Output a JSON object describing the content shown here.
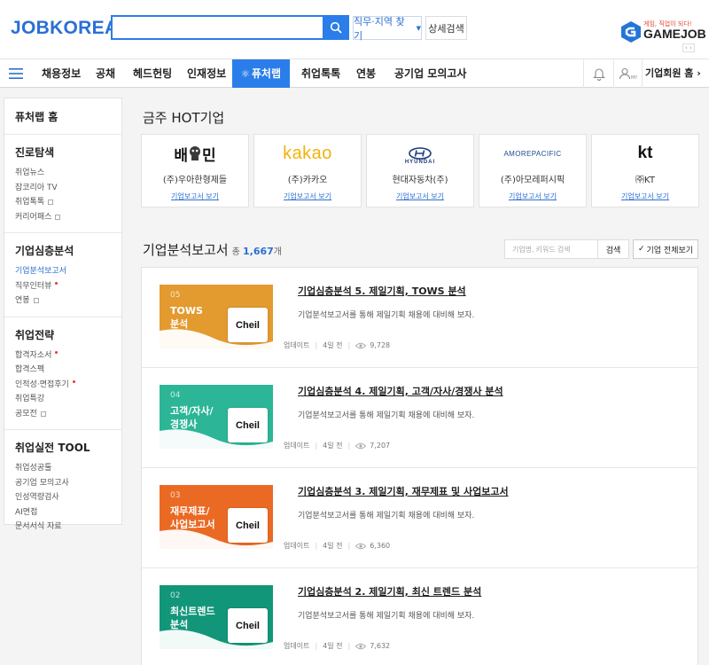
{
  "header": {
    "logo": "JOBKOREA",
    "search_placeholder": "",
    "region_button": "직무·지역 찾기",
    "detail_search_button": "상세검색",
    "gamejob_tagline": "게임, 직업이 되다!",
    "gamejob_name": "GAMEJOB",
    "gamejob_arrows": "‹ ›"
  },
  "nav": {
    "items": [
      "채용정보",
      "공채",
      "헤드헌팅",
      "인재정보",
      "퓨처랩",
      "취업톡톡",
      "연봉",
      "공기업 모의고사"
    ],
    "active_index": 4,
    "my_label": "MY",
    "corp_member": "기업회원 홈 ›"
  },
  "sidebar": {
    "home": "퓨처랩 홈",
    "sections": [
      {
        "title": "진로탐색",
        "items": [
          {
            "label": "취업뉴스"
          },
          {
            "label": "잡코리아 TV"
          },
          {
            "label": "취업톡톡",
            "box": true
          },
          {
            "label": "커리어패스",
            "box": true
          }
        ]
      },
      {
        "title": "기업심층분석",
        "items": [
          {
            "label": "기업분석보고서",
            "active": true
          },
          {
            "label": "직무인터뷰",
            "new": true
          },
          {
            "label": "연봉",
            "box": true
          }
        ]
      },
      {
        "title": "취업전략",
        "items": [
          {
            "label": "합격자소서",
            "new": true
          },
          {
            "label": "합격스펙"
          },
          {
            "label": "인적성·면접후기",
            "new": true
          },
          {
            "label": "취업특강"
          },
          {
            "label": "공모전",
            "box": true
          }
        ]
      },
      {
        "title": "취업실전 TOOL",
        "items": [
          {
            "label": "취업성공툴"
          },
          {
            "label": "공기업 모의고사"
          },
          {
            "label": "인성역량검사"
          },
          {
            "label": "AI면접"
          },
          {
            "label": "문서서식 자료"
          }
        ]
      }
    ]
  },
  "hot": {
    "title": "금주 HOT기업",
    "link_label": "기업보고서 보기",
    "companies": [
      {
        "logo_text": "배민",
        "logo_part1": "배",
        "logo_part2": "민",
        "name": "(주)우아한형제들"
      },
      {
        "logo_text": "kakao",
        "name": "(주)카카오"
      },
      {
        "logo_text": "HYUNDAI",
        "name": "현대자동차(주)"
      },
      {
        "logo_text": "AMOREPACIFIC",
        "name": "(주)아모레퍼시픽"
      },
      {
        "logo_text": "kt",
        "name": "㈜KT"
      }
    ]
  },
  "reports": {
    "title": "기업분석보고서",
    "total_prefix": "총",
    "count": "1,667",
    "count_suffix": "개",
    "search_placeholder": "기업명, 키워드 검색",
    "search_button": "검색",
    "all_button": "기업 전체보기",
    "items": [
      {
        "num": "05",
        "thumb_label": "TOWS\n분석",
        "brand": "Cheil",
        "color": "#e39a2f",
        "title": "기업심층분석 5. 제일기획, TOWS 분석",
        "desc": "기업분석보고서를 통해 제일기획 채용에 대비해 보자.",
        "meta_label": "업데이트",
        "updated": "4일 전",
        "views": "9,728"
      },
      {
        "num": "04",
        "thumb_label": "고객/자사/\n경쟁사",
        "brand": "Cheil",
        "color": "#2cb597",
        "title": "기업심층분석 4. 제일기획, 고객/자사/경쟁사 분석",
        "desc": "기업분석보고서를 통해 제일기획 채용에 대비해 보자.",
        "meta_label": "업데이트",
        "updated": "4일 전",
        "views": "7,207"
      },
      {
        "num": "03",
        "thumb_label": "재무제표/\n사업보고서",
        "brand": "Cheil",
        "color": "#ea6a24",
        "title": "기업심층분석 3. 제일기획, 재무제표 및 사업보고서",
        "desc": "기업분석보고서를 통해 제일기획 채용에 대비해 보자.",
        "meta_label": "업데이트",
        "updated": "4일 전",
        "views": "6,360"
      },
      {
        "num": "02",
        "thumb_label": "최신트렌드\n분석",
        "brand": "Cheil",
        "color": "#12967a",
        "title": "기업심층분석 2. 제일기획, 최신 트렌드 분석",
        "desc": "기업분석보고서를 통해 제일기획 채용에 대비해 보자.",
        "meta_label": "업데이트",
        "updated": "4일 전",
        "views": "7,632"
      }
    ]
  }
}
